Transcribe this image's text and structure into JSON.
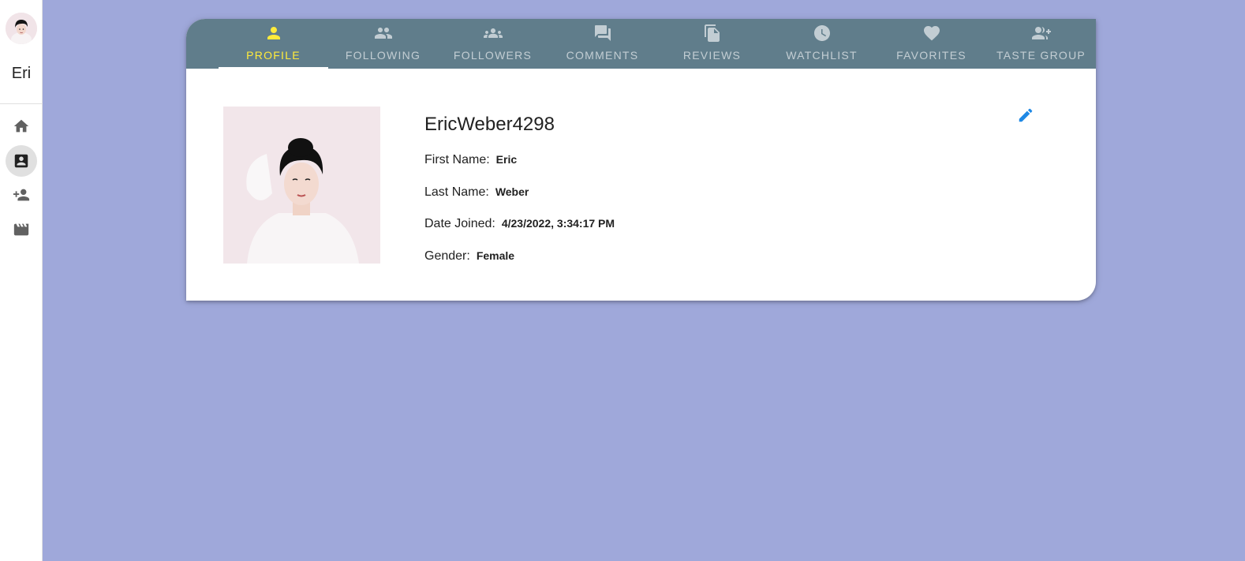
{
  "sidebar": {
    "user_short_name": "Eri",
    "nav_icons": [
      "home-icon",
      "profile-card-icon",
      "add-person-icon",
      "movie-icon"
    ],
    "active_index": 1
  },
  "tabs": [
    {
      "label": "PROFILE",
      "icon": "person-icon"
    },
    {
      "label": "FOLLOWING",
      "icon": "people-icon"
    },
    {
      "label": "FOLLOWERS",
      "icon": "groups-icon"
    },
    {
      "label": "COMMENTS",
      "icon": "forum-icon"
    },
    {
      "label": "REVIEWS",
      "icon": "file-copy-icon"
    },
    {
      "label": "WATCHLIST",
      "icon": "clock-icon"
    },
    {
      "label": "FAVORITES",
      "icon": "heart-icon"
    },
    {
      "label": "TASTE GROUP",
      "icon": "group-add-icon"
    }
  ],
  "active_tab": "PROFILE",
  "profile": {
    "username": "EricWeber4298",
    "fields": [
      {
        "key": "First Name:",
        "value": "Eric"
      },
      {
        "key": "Last Name:",
        "value": "Weber"
      },
      {
        "key": "Date Joined:",
        "value": "4/23/2022, 3:34:17 PM"
      },
      {
        "key": "Gender:",
        "value": "Female"
      }
    ]
  },
  "colors": {
    "background": "#9fa8da",
    "tab_bar": "#607d8b",
    "active_tab": "#ffeb3b",
    "edit_icon": "#1e88e5"
  }
}
